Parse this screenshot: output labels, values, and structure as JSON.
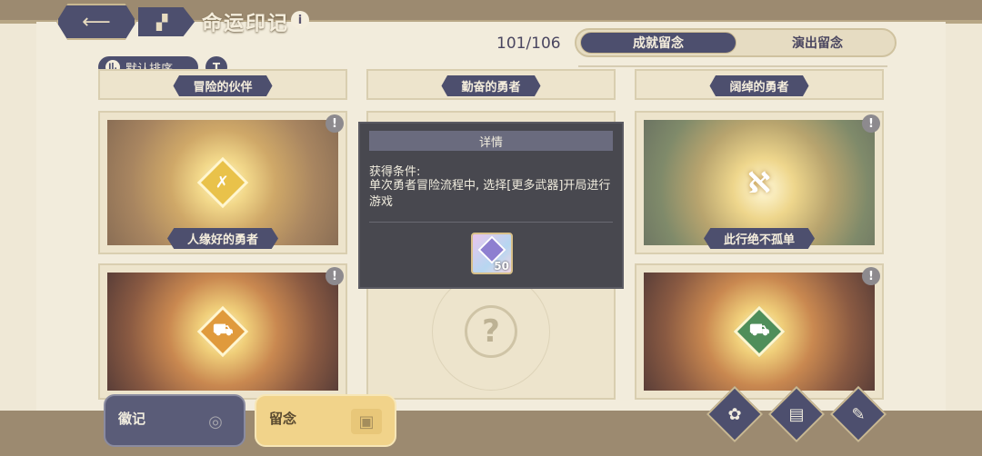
{
  "header": {
    "back_icon": "back-arrow-icon",
    "home_icon": "grid-home-icon",
    "title": "命运印记",
    "info_icon": "i"
  },
  "counter": "101/106",
  "tabs": [
    {
      "label": "成就留念",
      "active": true
    },
    {
      "label": "演出留念",
      "active": false
    }
  ],
  "sort": {
    "label": "默认排序",
    "icon": "Il."
  },
  "filter_icon": "T",
  "top_row_labels": [
    "冒险的伙伴",
    "勤奋的勇者",
    "阔绰的勇者"
  ],
  "cards": [
    {
      "label": "人缘好的勇者",
      "icon": "crossed-weapons-icon",
      "glyph": "✗",
      "alert": "!"
    },
    {
      "label": "此行绝不孤单",
      "icon": "crescent-swirl-icon",
      "glyph": "ℵ",
      "alert": "!"
    },
    {
      "label": "",
      "icon": "wagon-icon",
      "glyph": "⛟",
      "alert": "!"
    },
    {
      "label": "",
      "icon": "cart-icon",
      "glyph": "⛟",
      "alert": "!"
    },
    {
      "unknown": "?"
    },
    {
      "unknown": "?"
    }
  ],
  "popup": {
    "header": "详情",
    "label": "获得条件:",
    "text": "单次勇者冒险流程中, 选择[更多武器]开局进行游戏",
    "reward_count": "50",
    "reward_icon": "crystal-gem-icon"
  },
  "bottom_tabs": [
    {
      "label": "徽记",
      "active": false
    },
    {
      "label": "留念",
      "active": true
    }
  ],
  "bottom_buttons": [
    "flower-seal-icon",
    "book-icon",
    "scroll-quill-icon"
  ]
}
